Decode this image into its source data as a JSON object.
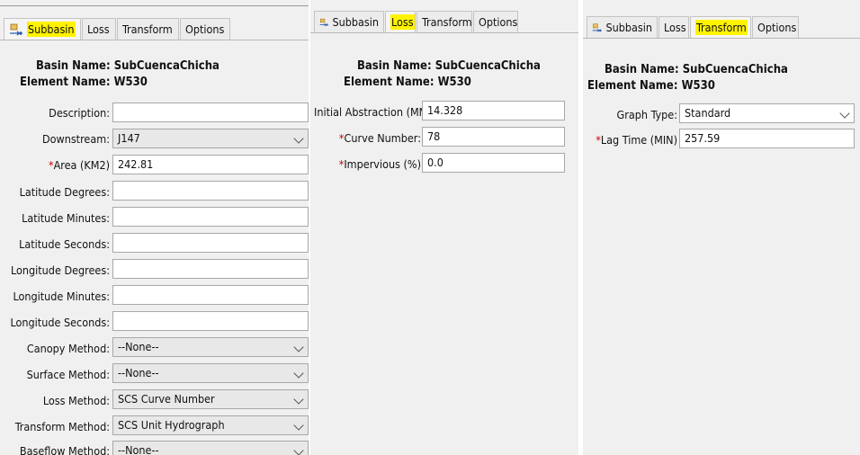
{
  "tabs": {
    "subbasin": "Subbasin",
    "loss": "Loss",
    "transform": "Transform",
    "options": "Options"
  },
  "basin_name_label": "Basin Name:",
  "basin_name": "SubCuencaChicha",
  "element_name_label": "Element Name:",
  "element_name": "W530",
  "subbasin_panel": {
    "description_label": "Description:",
    "description_value": "",
    "downstream_label": "Downstream:",
    "downstream_value": "J147",
    "area_label": "Area (KM2)",
    "area_value": "242.81",
    "lat_deg_label": "Latitude Degrees:",
    "lat_min_label": "Latitude Minutes:",
    "lat_sec_label": "Latitude Seconds:",
    "lon_deg_label": "Longitude Degrees:",
    "lon_min_label": "Longitude Minutes:",
    "lon_sec_label": "Longitude Seconds:",
    "canopy_label": "Canopy Method:",
    "canopy_value": "--None--",
    "surface_label": "Surface Method:",
    "surface_value": "--None--",
    "loss_label": "Loss Method:",
    "loss_value": "SCS Curve Number",
    "transform_label": "Transform Method:",
    "transform_value": "SCS Unit Hydrograph",
    "baseflow_label": "Baseflow Method:",
    "baseflow_value": "--None--"
  },
  "loss_panel": {
    "initial_abstraction_label": "Initial Abstraction (MM)",
    "initial_abstraction_value": "14.328",
    "curve_number_label": "Curve Number:",
    "curve_number_value": "78",
    "impervious_label": "Impervious (%)",
    "impervious_value": "0.0"
  },
  "transform_panel": {
    "graph_type_label": "Graph Type:",
    "graph_type_value": "Standard",
    "lag_time_label": "Lag Time (MIN)",
    "lag_time_value": "257.59"
  },
  "colors": {
    "highlight": "#fff300",
    "required": "#d00000",
    "panel_bg": "#f0f0f0"
  },
  "icons": {
    "subbasin_tab": "subbasin-icon",
    "dropdown": "chevron-down-icon"
  }
}
